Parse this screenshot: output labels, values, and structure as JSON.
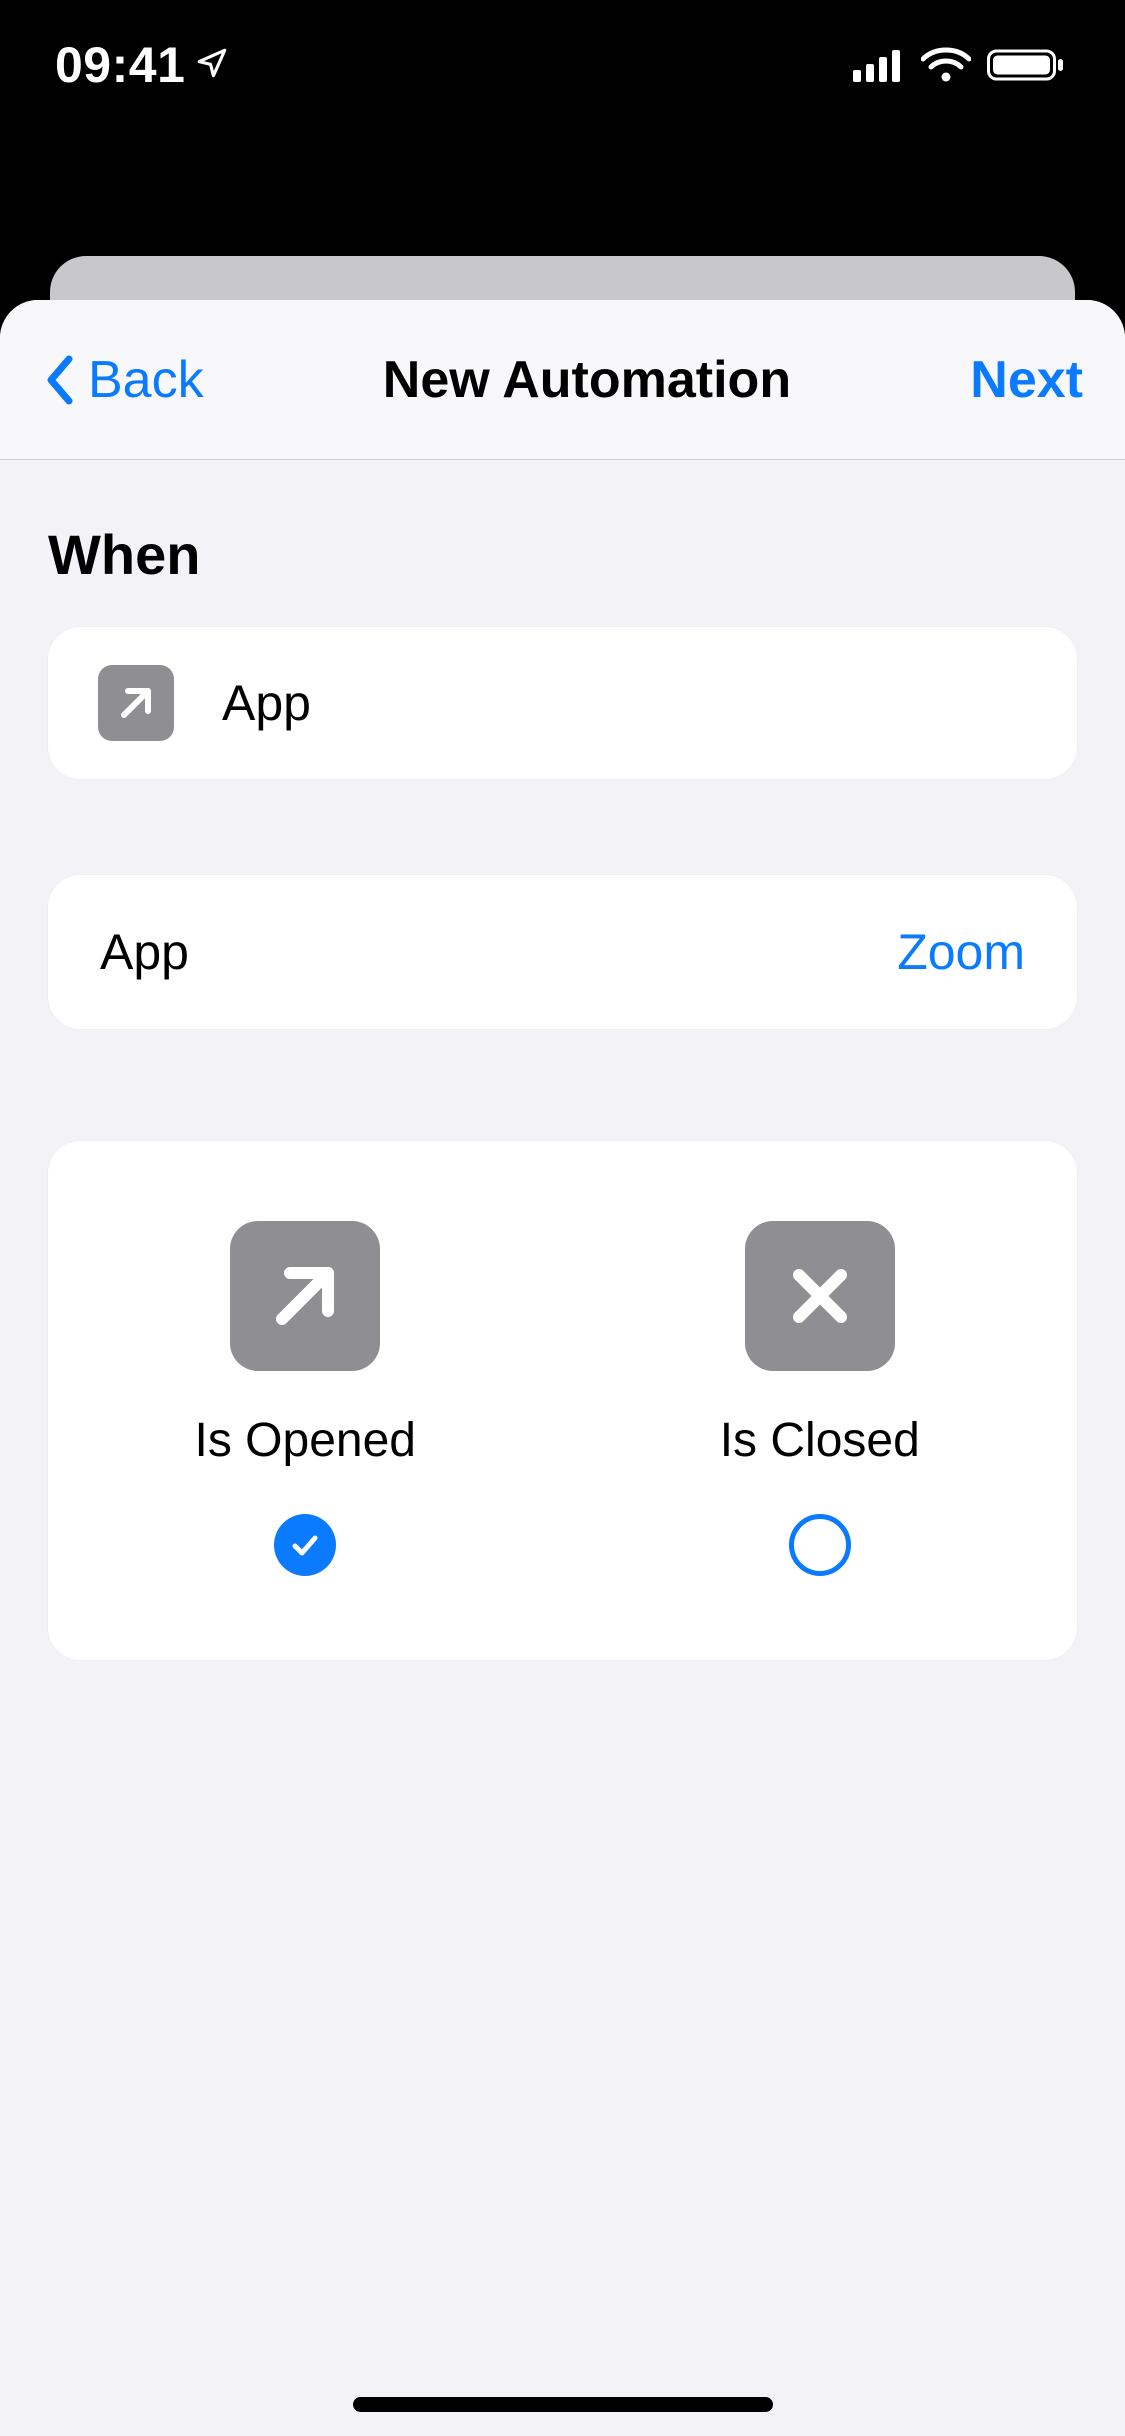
{
  "status_bar": {
    "time": "09:41"
  },
  "nav": {
    "back_label": "Back",
    "title": "New Automation",
    "next_label": "Next"
  },
  "section": {
    "heading": "When"
  },
  "trigger_row": {
    "label": "App"
  },
  "app_row": {
    "key": "App",
    "value": "Zoom"
  },
  "options": {
    "opened": {
      "label": "Is Opened",
      "selected": true
    },
    "closed": {
      "label": "Is Closed",
      "selected": false
    }
  }
}
